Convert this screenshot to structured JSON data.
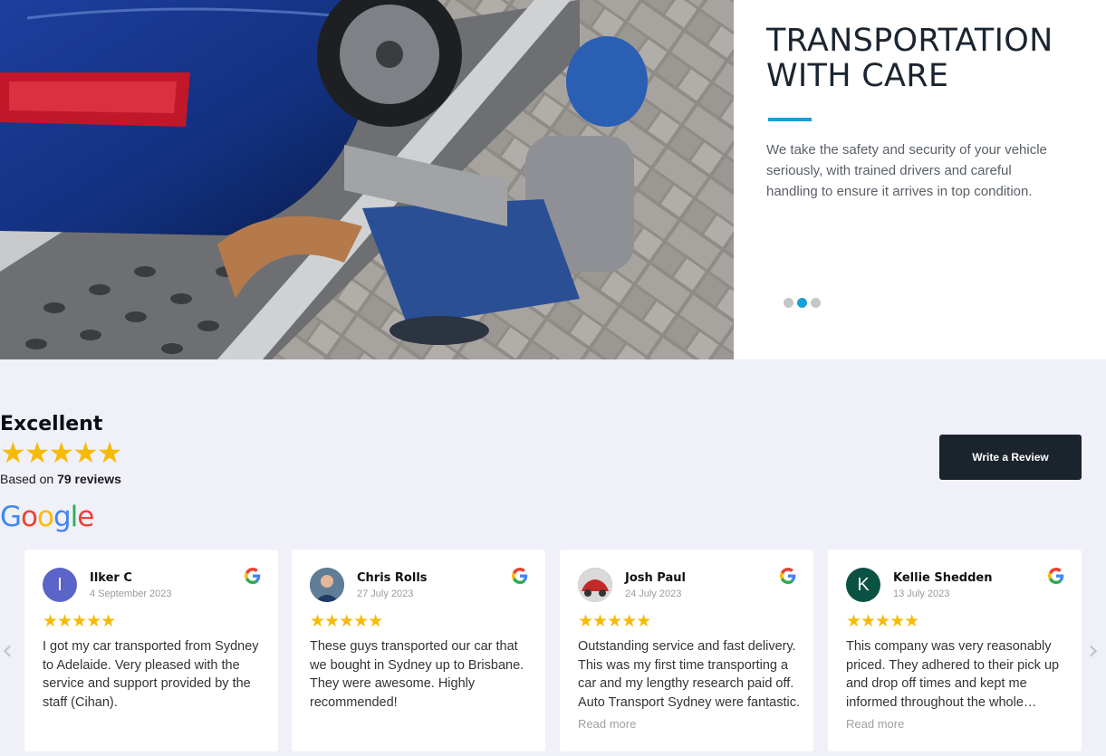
{
  "hero": {
    "title": "TRANSPORTATION\nWITH CARE",
    "description": "We take the safety and security of your vehicle seriously, with trained drivers and careful handling to ensure it arrives in top condition.",
    "slides": 3,
    "active_slide": 2,
    "accent_color": "#1a9fdd"
  },
  "summary": {
    "rating_word": "Excellent",
    "stars": "★★★★★",
    "based_on_prefix": "Based on ",
    "review_count": "79 reviews",
    "google": [
      "G",
      "o",
      "o",
      "g",
      "l",
      "e"
    ]
  },
  "write_review_label": "Write a Review",
  "nav": {
    "prev": "‹",
    "next": "›"
  },
  "reviews": [
    {
      "name": "Ilker C",
      "date": "4 September 2023",
      "initial": "I",
      "avatar_color": "#5b64c8",
      "stars": "★★★★★",
      "text": "I got my car transported from Sydney to Adelaide. Very pleased with the service and support provided by the staff (Cihan).",
      "read_more": ""
    },
    {
      "name": "Chris Rolls",
      "date": "27 July 2023",
      "initial": "",
      "avatar_color": "#4a6a85",
      "stars": "★★★★★",
      "text": "These guys transported our car that we bought in Sydney up to Brisbane. They were awesome. Highly recommended!",
      "read_more": ""
    },
    {
      "name": "Josh Paul",
      "date": "24 July 2023",
      "initial": "",
      "avatar_color": "#b23a3a",
      "stars": "★★★★★",
      "text": "Outstanding service and fast delivery. This was my first time transporting a car and my lengthy research paid off. Auto Transport Sydney were fantastic.",
      "read_more": "Read more"
    },
    {
      "name": "Kellie Shedden",
      "date": "13 July 2023",
      "initial": "K",
      "avatar_color": "#0c5244",
      "stars": "★★★★★",
      "text": "This company was very reasonably priced. They adhered to their pick up and drop off times and kept me informed throughout the whole process.",
      "read_more": "Read more"
    }
  ]
}
